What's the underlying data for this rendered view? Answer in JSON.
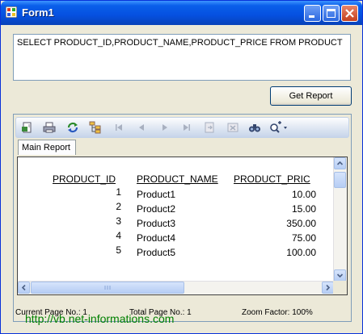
{
  "window": {
    "title": "Form1"
  },
  "query": {
    "text": "SELECT PRODUCT_ID,PRODUCT_NAME,PRODUCT_PRICE FROM PRODUCT"
  },
  "actions": {
    "get_report_label": "Get Report"
  },
  "viewer": {
    "toolbar_icons": [
      "export-icon",
      "print-icon",
      "refresh-icon",
      "group-tree-icon",
      "first-page-icon",
      "previous-page-icon",
      "next-page-icon",
      "last-page-icon",
      "goto-page-icon",
      "stop-icon",
      "search-icon",
      "zoom-icon"
    ],
    "tab_label": "Main Report",
    "report": {
      "headers": [
        "PRODUCT_ID",
        "PRODUCT_NAME",
        "PRODUCT_PRIC"
      ],
      "rows": [
        [
          "1",
          "Product1",
          "10.00"
        ],
        [
          "2",
          "Product2",
          "15.00"
        ],
        [
          "3",
          "Product3",
          "350.00"
        ],
        [
          "4",
          "Product4",
          "75.00"
        ],
        [
          "5",
          "Product5",
          "100.00"
        ]
      ]
    },
    "status": {
      "current_page": "Current Page No.: 1",
      "total_page": "Total Page No.: 1",
      "zoom": "Zoom Factor: 100%"
    }
  },
  "watermark": "http://vb.net-informations.com"
}
